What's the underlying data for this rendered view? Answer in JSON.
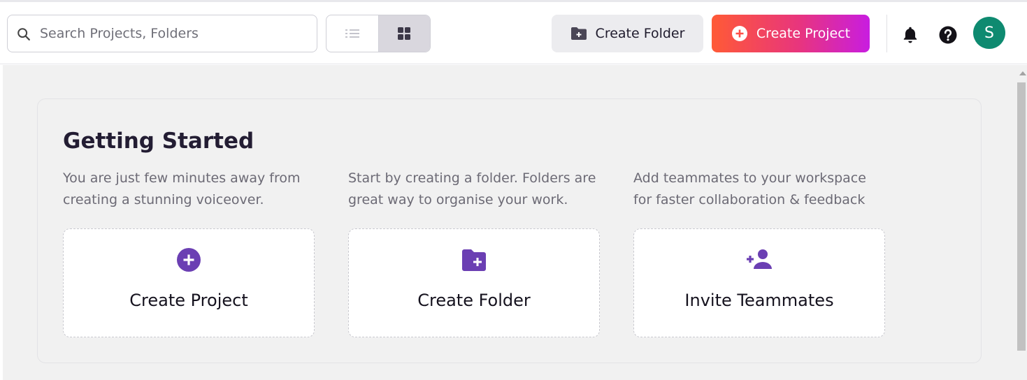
{
  "header": {
    "search": {
      "placeholder": "Search Projects, Folders",
      "value": ""
    },
    "view_toggle": {
      "options": [
        "list",
        "grid"
      ],
      "selected": "grid"
    },
    "create_folder_label": "Create Folder",
    "create_project_label": "Create Project",
    "avatar_initial": "S",
    "colors": {
      "accent_gradient": [
        "#ff5a36",
        "#e8357d",
        "#c81de0"
      ],
      "avatar": "#0e8a70",
      "icon_purple": "#6b3fb3"
    }
  },
  "getting_started": {
    "title": "Getting Started",
    "items": [
      {
        "description": "You are just few minutes away from creating a stunning voiceover.",
        "label": "Create Project",
        "icon": "plus-circle-icon"
      },
      {
        "description": "Start by creating a folder. Folders are great way to organise your work.",
        "label": "Create Folder",
        "icon": "folder-plus-icon"
      },
      {
        "description": "Add teammates to your workspace for faster collaboration & feedback",
        "label": "Invite Teammates",
        "icon": "user-plus-icon"
      }
    ]
  }
}
